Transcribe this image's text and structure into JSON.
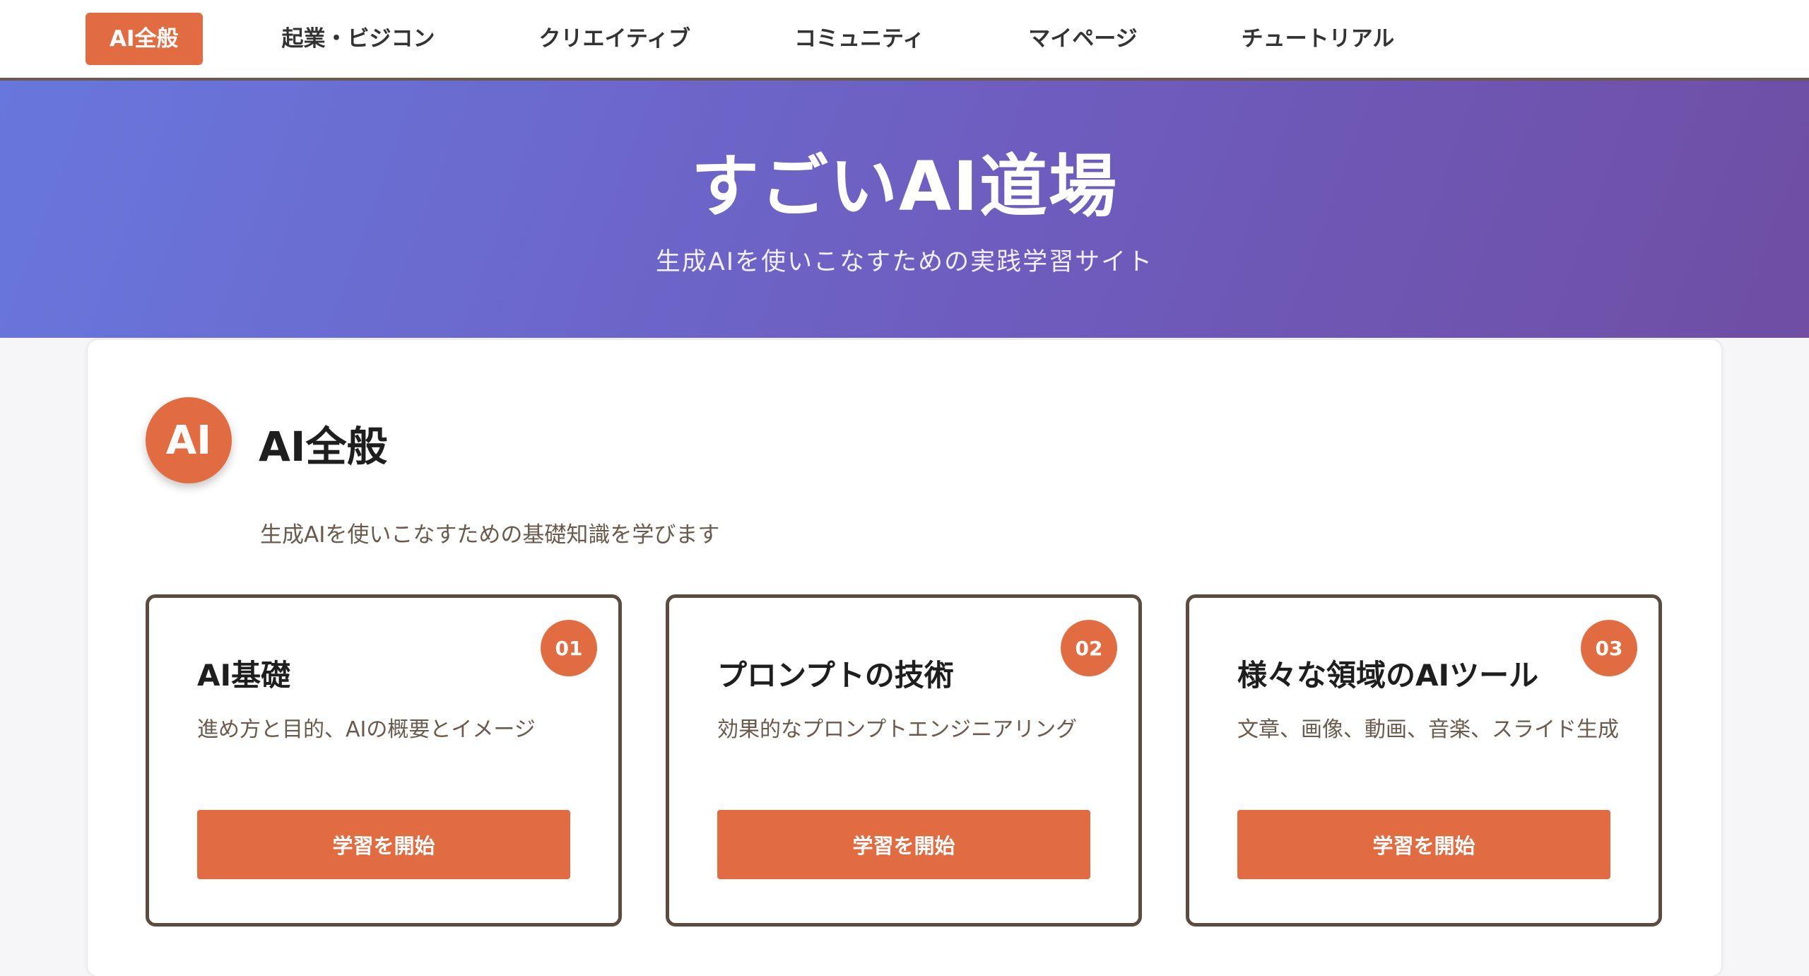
{
  "nav": {
    "items": [
      {
        "label": "AI全般",
        "active": true
      },
      {
        "label": "起業・ビジコン"
      },
      {
        "label": "クリエイティブ"
      },
      {
        "label": "コミュニティ"
      },
      {
        "label": "マイページ"
      },
      {
        "label": "チュートリアル"
      }
    ]
  },
  "hero": {
    "title": "すごいAI道場",
    "subtitle": "生成AIを使いこなすための実践学習サイト"
  },
  "section": {
    "badge": "AI",
    "title": "AI全般",
    "description": "生成AIを使いこなすための基礎知識を学びます"
  },
  "cards": [
    {
      "number": "01",
      "title": "AI基礎",
      "description": "進め方と目的、AIの概要とイメージ",
      "button": "学習を開始"
    },
    {
      "number": "02",
      "title": "プロンプトの技術",
      "description": "効果的なプロンプトエンジニアリング",
      "button": "学習を開始"
    },
    {
      "number": "03",
      "title": "様々な領域のAIツール",
      "description": "文章、画像、動画、音楽、スライド生成",
      "button": "学習を開始"
    }
  ],
  "colors": {
    "accent": "#e26c42",
    "hero_gradient_start": "#6877dd",
    "hero_gradient_end": "#6f4ea4",
    "card_border": "#5c4c40"
  }
}
